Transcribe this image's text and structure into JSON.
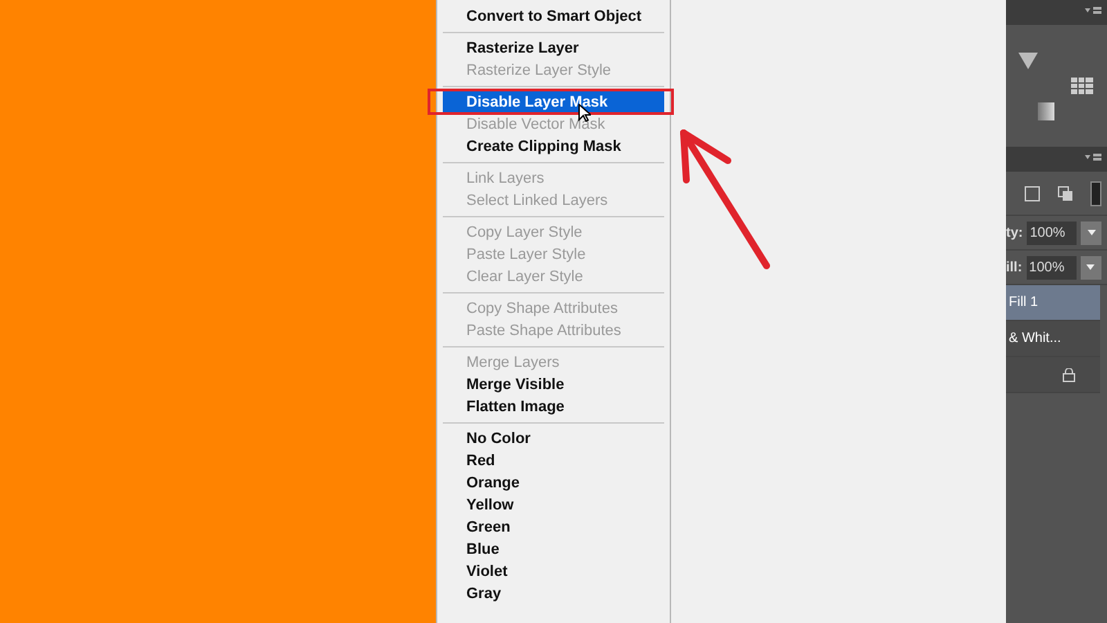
{
  "context_menu": {
    "groups": [
      [
        {
          "label": "Convert to Smart Object",
          "disabled": false,
          "selected": false
        }
      ],
      [
        {
          "label": "Rasterize Layer",
          "disabled": false,
          "selected": false
        },
        {
          "label": "Rasterize Layer Style",
          "disabled": true,
          "selected": false
        }
      ],
      [
        {
          "label": "Disable Layer Mask",
          "disabled": false,
          "selected": true
        },
        {
          "label": "Disable Vector Mask",
          "disabled": true,
          "selected": false
        },
        {
          "label": "Create Clipping Mask",
          "disabled": false,
          "selected": false
        }
      ],
      [
        {
          "label": "Link Layers",
          "disabled": true,
          "selected": false
        },
        {
          "label": "Select Linked Layers",
          "disabled": true,
          "selected": false
        }
      ],
      [
        {
          "label": "Copy Layer Style",
          "disabled": true,
          "selected": false
        },
        {
          "label": "Paste Layer Style",
          "disabled": true,
          "selected": false
        },
        {
          "label": "Clear Layer Style",
          "disabled": true,
          "selected": false
        }
      ],
      [
        {
          "label": "Copy Shape Attributes",
          "disabled": true,
          "selected": false
        },
        {
          "label": "Paste Shape Attributes",
          "disabled": true,
          "selected": false
        }
      ],
      [
        {
          "label": "Merge Layers",
          "disabled": true,
          "selected": false
        },
        {
          "label": "Merge Visible",
          "disabled": false,
          "selected": false
        },
        {
          "label": "Flatten Image",
          "disabled": false,
          "selected": false
        }
      ],
      [
        {
          "label": "No Color",
          "disabled": false,
          "selected": false
        },
        {
          "label": "Red",
          "disabled": false,
          "selected": false
        },
        {
          "label": "Orange",
          "disabled": false,
          "selected": false
        },
        {
          "label": "Yellow",
          "disabled": false,
          "selected": false
        },
        {
          "label": "Green",
          "disabled": false,
          "selected": false
        },
        {
          "label": "Blue",
          "disabled": false,
          "selected": false
        },
        {
          "label": "Violet",
          "disabled": false,
          "selected": false
        },
        {
          "label": "Gray",
          "disabled": false,
          "selected": false
        }
      ]
    ]
  },
  "layers_panel": {
    "opacity_label": "ty:",
    "opacity": "100%",
    "fill_label": "ill:",
    "fill": "100%",
    "layers": [
      {
        "name": "Fill 1",
        "selected": true,
        "locked": false
      },
      {
        "name": "& Whit...",
        "selected": false,
        "locked": false
      },
      {
        "selected": false,
        "locked": true
      }
    ]
  }
}
